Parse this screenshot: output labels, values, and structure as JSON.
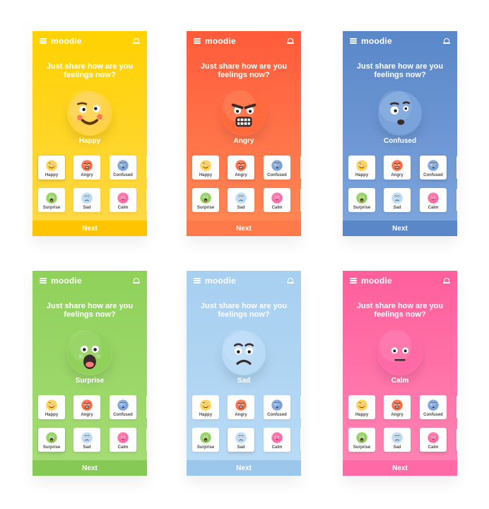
{
  "brand": "moodie",
  "question_line1": "Just share how are you",
  "question_line2": "feelings now?",
  "next_label": "Next",
  "mood_options": [
    "Happy",
    "Angry",
    "Confused",
    "Surprise",
    "Sad",
    "Calm"
  ],
  "screens": [
    {
      "selected": "Happy",
      "theme": {
        "top": "#ffd200",
        "bottom": "#ffd84a",
        "bar": "#ffc400"
      },
      "face": "happy"
    },
    {
      "selected": "Angry",
      "theme": {
        "top": "#ff5b3b",
        "bottom": "#ff8a56",
        "bar": "#ff7a4a"
      },
      "face": "angry"
    },
    {
      "selected": "Confused",
      "theme": {
        "top": "#5a87c8",
        "bottom": "#7fa6de",
        "bar": "#5a87c8"
      },
      "face": "confused"
    },
    {
      "selected": "Surprise",
      "theme": {
        "top": "#8fd15a",
        "bottom": "#a6dc76",
        "bar": "#86c955"
      },
      "face": "surprise"
    },
    {
      "selected": "Sad",
      "theme": {
        "top": "#a7cff0",
        "bottom": "#b9dbf6",
        "bar": "#9cc7ec"
      },
      "face": "sad"
    },
    {
      "selected": "Calm",
      "theme": {
        "top": "#ff5f9c",
        "bottom": "#ff86b4",
        "bar": "#ff6aa6"
      },
      "face": "calm"
    }
  ],
  "mini_face_colors": {
    "Happy": "#ffd24a",
    "Angry": "#ff6a3d",
    "Confused": "#7aa3db",
    "Surprise": "#8fd15a",
    "Sad": "#b9dbf6",
    "Calm": "#ff6aa6"
  },
  "icons": {
    "menu": "hamburger-icon",
    "notifications": "bell-icon"
  }
}
